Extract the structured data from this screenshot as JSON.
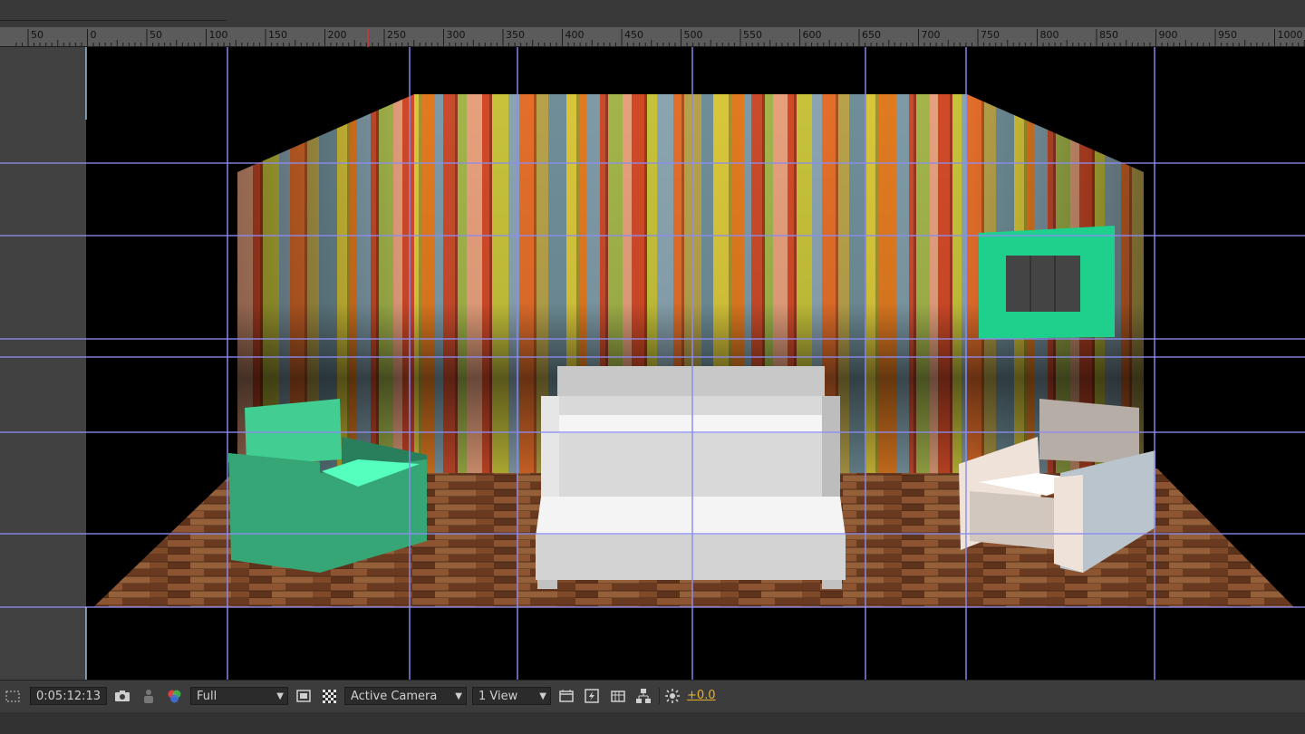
{
  "window": {
    "title": ""
  },
  "ruler": {
    "ticks": [
      "50",
      "0",
      "50",
      "100",
      "150",
      "200",
      "250",
      "300",
      "350",
      "400",
      "450",
      "500",
      "550",
      "600",
      "650",
      "700",
      "750",
      "800",
      "850",
      "900",
      "950",
      "1000"
    ],
    "current_marker_color": "#c8392e"
  },
  "viewer": {
    "guide_color": "#8c8cf0",
    "scene": {
      "wall_stripe_colors": [
        "#d8c63a",
        "#e07a20",
        "#7e9aa6",
        "#c94b2b",
        "#a2b44a",
        "#e6a07c",
        "#d14a28",
        "#c6c23a",
        "#8aa4b0",
        "#e36e2a",
        "#b7a24a",
        "#6f8e98"
      ],
      "floor_color": "#7a4628",
      "left_chair_color": "#3fc38c",
      "sofa_color": "#e2e2e2",
      "right_chair_color": "#e4d8cf",
      "frame_color": "#1fcf8c",
      "frame_window_color": "#444444"
    }
  },
  "statusbar": {
    "timecode": "0:05:12:13",
    "resolution": "Full",
    "camera": "Active Camera",
    "views": "1 View",
    "exposure": "+0.0",
    "icons": {
      "region_of_interest": "region-of-interest-icon",
      "snapshot": "camera-snapshot-icon",
      "show_snapshot": "show-snapshot-person-icon",
      "channels": "color-channels-icon",
      "toggle_mask": "toggle-mask-icon",
      "transparency_grid": "transparency-grid-icon",
      "view_options": "view-options-icon",
      "fast_previews": "fast-previews-icon",
      "timeline": "timeline-icon",
      "flowchart": "flowchart-icon",
      "reset_exposure": "reset-exposure-icon"
    }
  }
}
